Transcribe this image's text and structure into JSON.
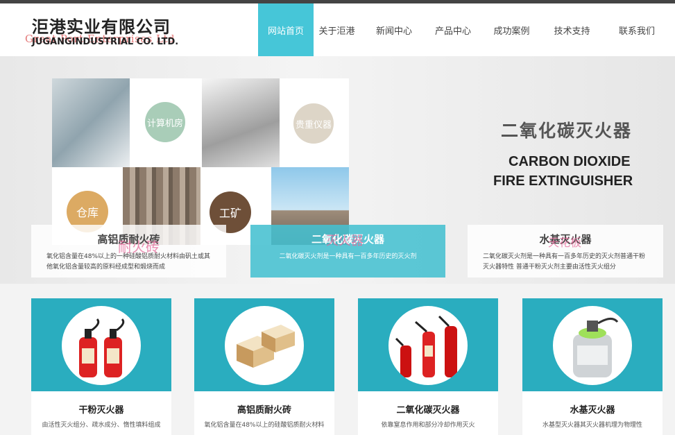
{
  "header": {
    "logo_cn": "洰港实业有限公司",
    "logo_en_overlay": "Great Port Enterprises Ltd",
    "logo_en": "JUGANGINDUSTRIAL CO. LTD."
  },
  "nav": {
    "items": [
      {
        "label": "网站首页",
        "active": true
      },
      {
        "label": "关于洰港",
        "active": false
      },
      {
        "label": "新闻中心",
        "active": false
      },
      {
        "label": "产品中心",
        "active": false
      },
      {
        "label": "成功案例",
        "active": false
      },
      {
        "label": "技术支持",
        "active": false
      },
      {
        "label": "联系我们",
        "active": false
      }
    ],
    "active_color": "#46c6d8"
  },
  "banner": {
    "tiles": {
      "computer_room": "计算机房",
      "precision_instrument": "贵重仪器",
      "warehouse": "仓库",
      "mining": "工矿"
    },
    "title_cn": "二氧化碳灭火器",
    "title_en_line1": "CARBON DIOXIDE",
    "title_en_line2": "FIRE EXTINGUISHER",
    "cards": [
      {
        "title": "高铝质耐火砖",
        "overlay": "耐火砖",
        "desc": "氧化铝含量在48%以上的一种硅酸铝质耐火材料由矾土或其他氧化铝含量较高的原料经成型和煅烧而成"
      },
      {
        "title": "二氧化碳灭火器",
        "overlay": "灭火器",
        "desc": "二氧化碳灭火剂是一种具有一百多年历史的灭火剂"
      },
      {
        "title": "水基灭火器",
        "overlay": "天花板",
        "desc": "二氧化碳灭火剂是一种具有一百多年历史的灭火剂普通干粉灭火器特性 普通干粉灭火剂主要由活性灭火组分"
      }
    ]
  },
  "products": [
    {
      "title": "干粉灭火器",
      "desc": "由活性灭火组分、疏水成分、惰性填料组成"
    },
    {
      "title": "高铝质耐火砖",
      "desc": "氧化铝含量在48%以上的硅酸铝质耐火材料"
    },
    {
      "title": "二氧化碳灭火器",
      "desc": "依靠窒息作用和部分冷却作用灭火"
    },
    {
      "title": "水基灭火器",
      "desc": "水基型灭火器其灭火器机理为物理性"
    }
  ],
  "colors": {
    "teal": "#2aadbf",
    "accent": "#46c6d8"
  }
}
